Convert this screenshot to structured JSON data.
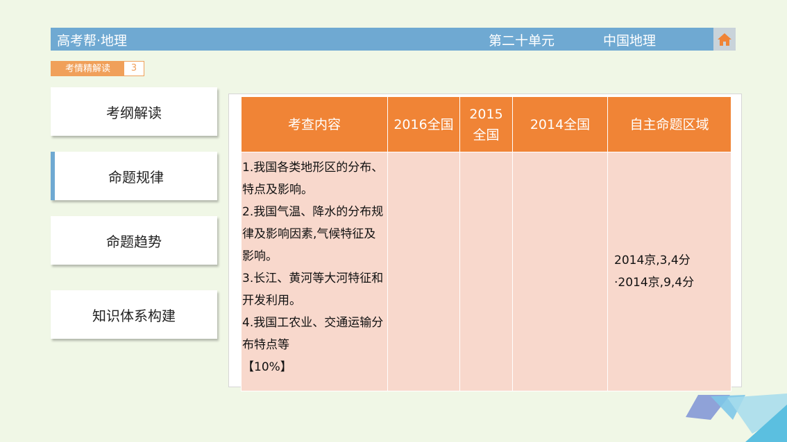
{
  "header": {
    "title": "高考帮·地理",
    "unit": "第二十单元",
    "subject": "中国地理"
  },
  "section_tag": {
    "label": "考情精解读",
    "number": "3"
  },
  "sidebar": {
    "items": [
      {
        "label": "考纲解读"
      },
      {
        "label": "命题规律"
      },
      {
        "label": "命题趋势"
      },
      {
        "label": "知识体系构建"
      }
    ]
  },
  "table": {
    "headers": [
      "考查内容",
      "2016全国",
      "2015全国",
      "2014全国",
      "自主命题区域"
    ],
    "content_lines": [
      "1.我国各类地形区的分布、",
      "特点及影响。",
      "2.我国气温、降水的分布规",
      "律及影响因素,气候特征及",
      "影响。",
      "3.长江、黄河等大河特征和",
      "开发利用。",
      "4.我国工农业、交通运输分",
      "布特点等",
      "【10%】"
    ],
    "region_lines": [
      "2014京,3,4分",
      "·2014京,9,4分"
    ]
  },
  "colors": {
    "header_bg": "#6fa9d2",
    "table_header": "#f08436",
    "table_cell": "#f8d8cc",
    "tag": "#f0a05a"
  }
}
